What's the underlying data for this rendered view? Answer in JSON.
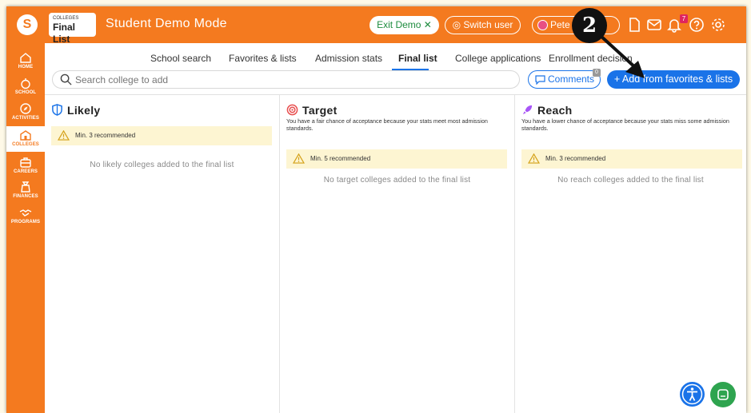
{
  "header": {
    "logo": "S",
    "breadcrumb_section": "COLLEGES",
    "breadcrumb_page": "Final List",
    "mode_title": "Student Demo Mode",
    "exit_demo": "Exit Demo ✕",
    "switch_user": "Switch user",
    "user_name": "Pete",
    "notification_count": "7",
    "step_number": "2"
  },
  "sidebar": {
    "items": [
      {
        "label": "HOME",
        "icon": "home-icon"
      },
      {
        "label": "SCHOOL",
        "icon": "apple-icon"
      },
      {
        "label": "ACTIVITIES",
        "icon": "compass-icon"
      },
      {
        "label": "COLLEGES",
        "icon": "college-icon"
      },
      {
        "label": "CAREERS",
        "icon": "briefcase-icon"
      },
      {
        "label": "FINANCES",
        "icon": "money-bag-icon"
      },
      {
        "label": "PROGRAMS",
        "icon": "handshake-icon"
      }
    ]
  },
  "tabs": [
    {
      "label": "School search"
    },
    {
      "label": "Favorites & lists"
    },
    {
      "label": "Admission stats"
    },
    {
      "label": "Final list"
    },
    {
      "label": "College applications"
    },
    {
      "label": "Enrollment decision"
    }
  ],
  "search": {
    "placeholder": "Search college to add"
  },
  "comments": {
    "label": "Comments",
    "count": "0"
  },
  "add_button": "+ Add from favorites & lists",
  "columns": [
    {
      "title": "Likely",
      "description": "",
      "recommended": "Min. 3 recommended",
      "empty": "No likely colleges added to the final list",
      "color": "#1a73e8"
    },
    {
      "title": "Target",
      "description": "You have a fair chance of acceptance because your stats meet most admission standards.",
      "recommended": "Min. 5 recommended",
      "empty": "No target colleges added to the final list",
      "color": "#e84f4f"
    },
    {
      "title": "Reach",
      "description": "You have a lower chance of acceptance because your stats miss some admission standards.",
      "recommended": "Min. 3 recommended",
      "empty": "No reach colleges added to the final list",
      "color": "#a855f7"
    }
  ],
  "colors": {
    "brand_orange": "#f47a1f",
    "primary_blue": "#1a73e8",
    "warning_bg": "#fdf5d2",
    "chat_green": "#2ea44f"
  }
}
